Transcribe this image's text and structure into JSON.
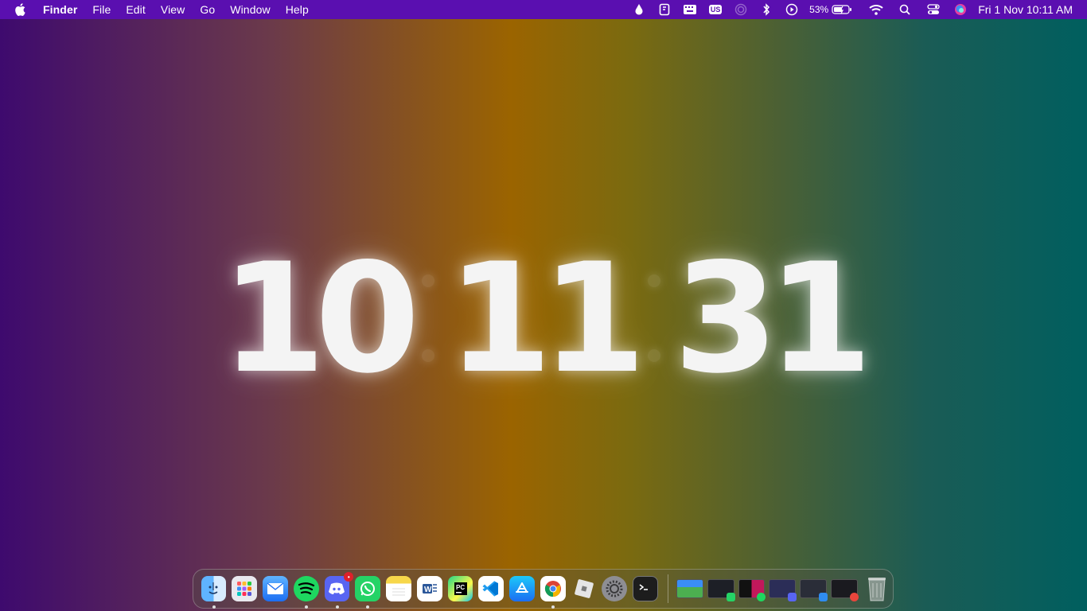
{
  "menubar": {
    "app_name": "Finder",
    "menus": [
      "File",
      "Edit",
      "View",
      "Go",
      "Window",
      "Help"
    ],
    "status_icons": [
      "drop-icon",
      "script-icon",
      "keyboard-icon",
      "input-source-icon",
      "airdrop-icon",
      "bluetooth-icon",
      "play-icon",
      "battery-icon",
      "wifi-icon",
      "search-icon",
      "control-center-icon",
      "siri-icon"
    ],
    "input_source": "US",
    "battery_percent": "53%",
    "datetime": "Fri 1 Nov  10:11 AM"
  },
  "clock": {
    "hours": "10",
    "minutes": "11",
    "seconds": "31"
  },
  "dock": {
    "apps": [
      {
        "name": "Finder",
        "running": true,
        "color": "#2f8cf0"
      },
      {
        "name": "Launchpad",
        "running": false,
        "color": "#e9e9ee"
      },
      {
        "name": "Mail",
        "running": false,
        "color": "#3a8ef6"
      },
      {
        "name": "Spotify",
        "running": true,
        "color": "#1ed760"
      },
      {
        "name": "Discord",
        "running": true,
        "color": "#5865f2",
        "badge": "•"
      },
      {
        "name": "WhatsApp",
        "running": true,
        "color": "#25d366"
      },
      {
        "name": "Notes",
        "running": false,
        "color": "#f7d74a"
      },
      {
        "name": "Word",
        "running": false,
        "color": "#ffffff"
      },
      {
        "name": "PyCharm",
        "running": false,
        "color": "#21d789"
      },
      {
        "name": "Visual Studio Code",
        "running": false,
        "color": "#ffffff"
      },
      {
        "name": "App Store",
        "running": false,
        "color": "#1c8ef9"
      },
      {
        "name": "Google Chrome",
        "running": true,
        "color": "#ffffff"
      },
      {
        "name": "Roblox",
        "running": false,
        "color": "#d9d9d9"
      },
      {
        "name": "System Settings",
        "running": false,
        "color": "#8e8e93"
      },
      {
        "name": "Terminal",
        "running": false,
        "color": "#1d1d1d"
      }
    ],
    "minimized": [
      {
        "name": "window-photos",
        "badge_color": ""
      },
      {
        "name": "window-whatsapp",
        "badge_color": "#25d366"
      },
      {
        "name": "window-spotify",
        "badge_color": "#1ed760"
      },
      {
        "name": "window-discord",
        "badge_color": "#5865f2"
      },
      {
        "name": "window-finder",
        "badge_color": "#2f8cf0"
      },
      {
        "name": "window-chrome",
        "badge_color": "#e8453c"
      }
    ],
    "trash": "Trash"
  }
}
